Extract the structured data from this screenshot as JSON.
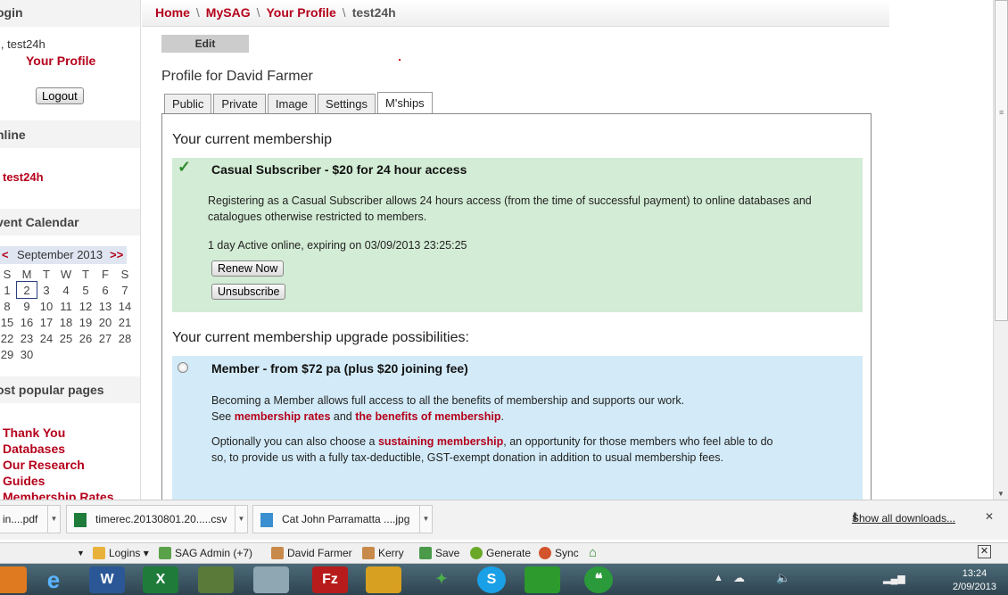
{
  "sidebar": {
    "login_heading": "ogin",
    "greeting": "i, test24h",
    "your_profile": "Your Profile",
    "logout": "Logout",
    "online_heading": "nline",
    "online_user": "test24h",
    "calendar_heading": "vent Calendar",
    "calendar": {
      "prev": "<",
      "month": "September 2013",
      "next": ">>",
      "weekdays": [
        "S",
        "M",
        "T",
        "W",
        "T",
        "F",
        "S"
      ],
      "weeks": [
        [
          "1",
          "2",
          "3",
          "4",
          "5",
          "6",
          "7"
        ],
        [
          "8",
          "9",
          "10",
          "11",
          "12",
          "13",
          "14"
        ],
        [
          "15",
          "16",
          "17",
          "18",
          "19",
          "20",
          "21"
        ],
        [
          "22",
          "23",
          "24",
          "25",
          "26",
          "27",
          "28"
        ],
        [
          "29",
          "30",
          "",
          "",
          "",
          "",
          ""
        ]
      ],
      "today": "2"
    },
    "popular_heading": "ost popular pages",
    "popular_links": [
      "Thank You",
      "Databases",
      "Our Research",
      "Guides",
      "Membership Rates"
    ]
  },
  "breadcrumb": {
    "home": "Home",
    "mysag": "MySAG",
    "your_profile": "Your Profile",
    "current": "test24h",
    "separator": "\\"
  },
  "edit_label": "Edit",
  "profile_title": "Profile for David Farmer",
  "tabs": [
    "Public",
    "Private",
    "Image",
    "Settings",
    "M'ships"
  ],
  "active_tab": "M'ships",
  "membership": {
    "current_heading": "Your current membership",
    "current_title": "Casual Subscriber - $20 for 24 hour access",
    "current_desc_1": "Registering as a Casual Subscriber allows 24 hours access (from the time of successful payment) to online databases and",
    "current_desc_2": "catalogues otherwise restricted to members.",
    "current_status": "1 day Active online, expiring on 03/09/2013 23:25:25",
    "renew": "Renew Now",
    "unsubscribe": "Unsubscribe",
    "upgrade_heading": "Your current membership upgrade possibilities:",
    "upgrade_title": "Member - from $72 pa (plus $20 joining fee)",
    "upgrade_desc_1": "Becoming a Member allows full access to all the benefits of membership and supports our work.",
    "upgrade_see": "See",
    "upgrade_link_rates": "membership rates",
    "upgrade_and": "and",
    "upgrade_link_benefits": "the benefits of membership",
    "upgrade_period": ".",
    "upgrade_opt_1": "Optionally you can also choose a",
    "upgrade_link_sustaining": "sustaining membership",
    "upgrade_opt_2": ", an opportunity for those members who feel able to do",
    "upgrade_opt_3": "so, to provide us with a fully tax-deductible, GST-exempt donation in addition to usual membership fees."
  },
  "downloads": {
    "items": [
      "in....pdf",
      "timerec.20130801.20.....csv",
      "Cat John Parramatta ....jpg"
    ],
    "show_all": "Show all downloads...",
    "close": "✕"
  },
  "bookmarks": [
    "Logins",
    "SAG Admin (+7)",
    "David Farmer",
    "Kerry",
    "Save",
    "Generate",
    "Sync"
  ],
  "clock": {
    "time": "13:24",
    "date": "2/09/2013"
  },
  "colors": {
    "accent_red": "#b5001b",
    "current_box": "#d3ecd5",
    "upgrade_box": "#d3ebf8"
  }
}
